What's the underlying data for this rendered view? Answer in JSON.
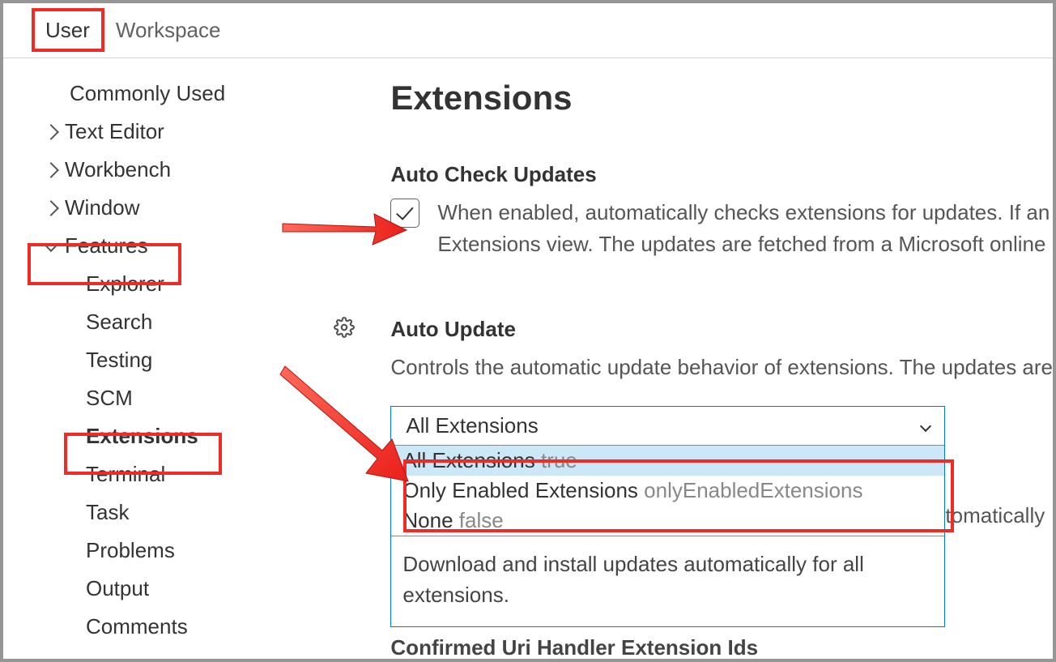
{
  "tabs": {
    "user": "User",
    "workspace": "Workspace"
  },
  "sidebar": {
    "commonly_used": "Commonly Used",
    "text_editor": "Text Editor",
    "workbench": "Workbench",
    "window": "Window",
    "features": "Features",
    "features_children": {
      "explorer": "Explorer",
      "search": "Search",
      "testing": "Testing",
      "scm": "SCM",
      "extensions": "Extensions",
      "terminal": "Terminal",
      "task": "Task",
      "problems": "Problems",
      "output": "Output",
      "comments": "Comments"
    }
  },
  "main": {
    "title": "Extensions",
    "auto_check": {
      "title": "Auto Check Updates",
      "checked": true,
      "desc1": "When enabled, automatically checks extensions for updates. If an ",
      "desc2": "Extensions view. The updates are fetched from a Microsoft online "
    },
    "auto_update": {
      "title": "Auto Update",
      "desc": "Controls the automatic update behavior of extensions. The updates are",
      "selected": "All Extensions",
      "options": [
        {
          "label": "All Extensions",
          "value": "true"
        },
        {
          "label": "Only Enabled Extensions",
          "value": "onlyEnabledExtensions"
        },
        {
          "label": "None",
          "value": "false"
        }
      ],
      "hint": "Download and install updates automatically for all extensions.",
      "trailing": "tomatically"
    },
    "next_header": "Confirmed Uri Handler Extension Ids"
  }
}
